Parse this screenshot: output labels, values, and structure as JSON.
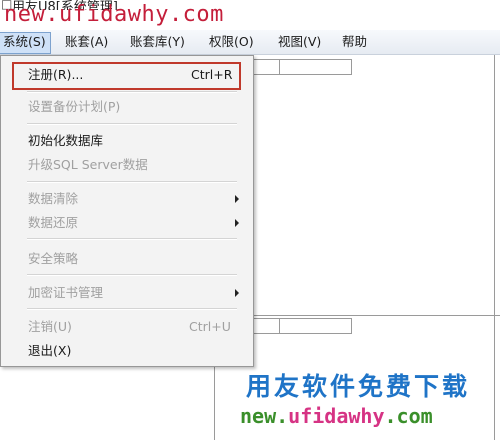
{
  "window": {
    "title": "用友U8[系统管理]"
  },
  "menubar": {
    "items": [
      {
        "label": "系统(S)"
      },
      {
        "label": "账套(A)"
      },
      {
        "label": "账套库(Y)"
      },
      {
        "label": "权限(O)"
      },
      {
        "label": "视图(V)"
      },
      {
        "label": "帮助"
      }
    ]
  },
  "system_menu": {
    "register": {
      "label": "注册(R)...",
      "shortcut": "Ctrl+R"
    },
    "backup_plan": {
      "label": "设置备份计划(P)"
    },
    "init_db": {
      "label": "初始化数据库"
    },
    "upgrade_sql": {
      "label": "升级SQL Server数据"
    },
    "data_clear": {
      "label": "数据清除"
    },
    "data_restore": {
      "label": "数据还原"
    },
    "security_policy": {
      "label": "安全策略"
    },
    "cert_mgmt": {
      "label": "加密证书管理"
    },
    "logout": {
      "label": "注销(U)",
      "shortcut": "Ctrl+U"
    },
    "exit": {
      "label": "退出(X)"
    }
  },
  "watermark": {
    "top_url": "new.ufidawhy.com",
    "logo_text": "用友软件免费下载",
    "bottom_url_prefix": "new.",
    "bottom_url_domain": "ufidawhy",
    "bottom_url_suffix": ".com"
  },
  "colors": {
    "highlight_border": "#c0392b",
    "watermark_red": "#c41e3a",
    "watermark_blue": "#1f74c7",
    "watermark_green": "#3a8f2a",
    "watermark_pink": "#d63384"
  }
}
